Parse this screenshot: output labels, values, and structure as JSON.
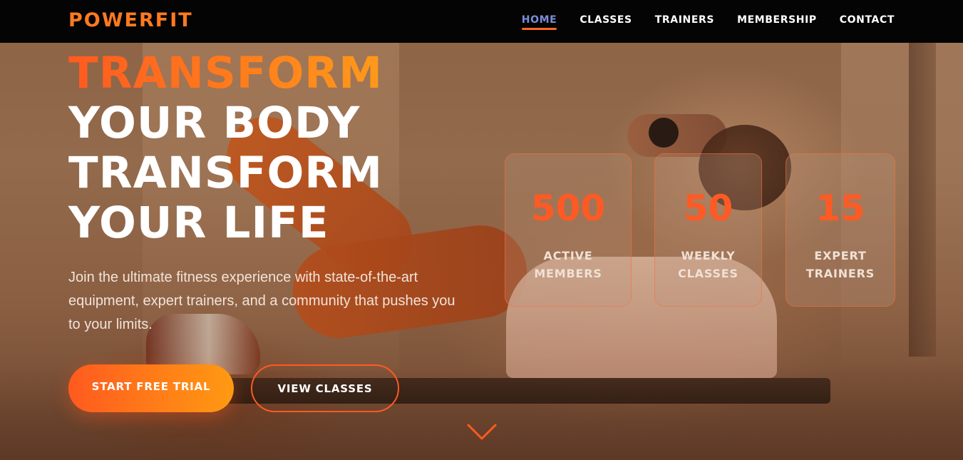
{
  "brand": {
    "logo": "POWERFIT"
  },
  "nav": {
    "items": [
      {
        "label": "HOME",
        "active": true
      },
      {
        "label": "CLASSES",
        "active": false
      },
      {
        "label": "TRAINERS",
        "active": false
      },
      {
        "label": "MEMBERSHIP",
        "active": false
      },
      {
        "label": "CONTACT",
        "active": false
      }
    ]
  },
  "hero": {
    "headline": {
      "accent": "TRANSFORM",
      "line2": "YOUR BODY",
      "line3": "TRANSFORM",
      "line4": "YOUR LIFE"
    },
    "subtext": "Join the ultimate fitness experience with state-of-the-art equipment, expert trainers, and a community that pushes you to your limits.",
    "cta_primary": "START FREE TRIAL",
    "cta_secondary": "VIEW CLASSES",
    "scroll_icon": "chevron-down-icon"
  },
  "stats": [
    {
      "value": "500",
      "label": "ACTIVE MEMBERS"
    },
    {
      "value": "50",
      "label": "WEEKLY CLASSES"
    },
    {
      "value": "15",
      "label": "EXPERT TRAINERS"
    }
  ],
  "colors": {
    "accent": "#ff5a1f",
    "accent_gradient_end": "#ff9a12",
    "nav_active": "#7b8dd8",
    "navbar_bg": "#050404"
  }
}
